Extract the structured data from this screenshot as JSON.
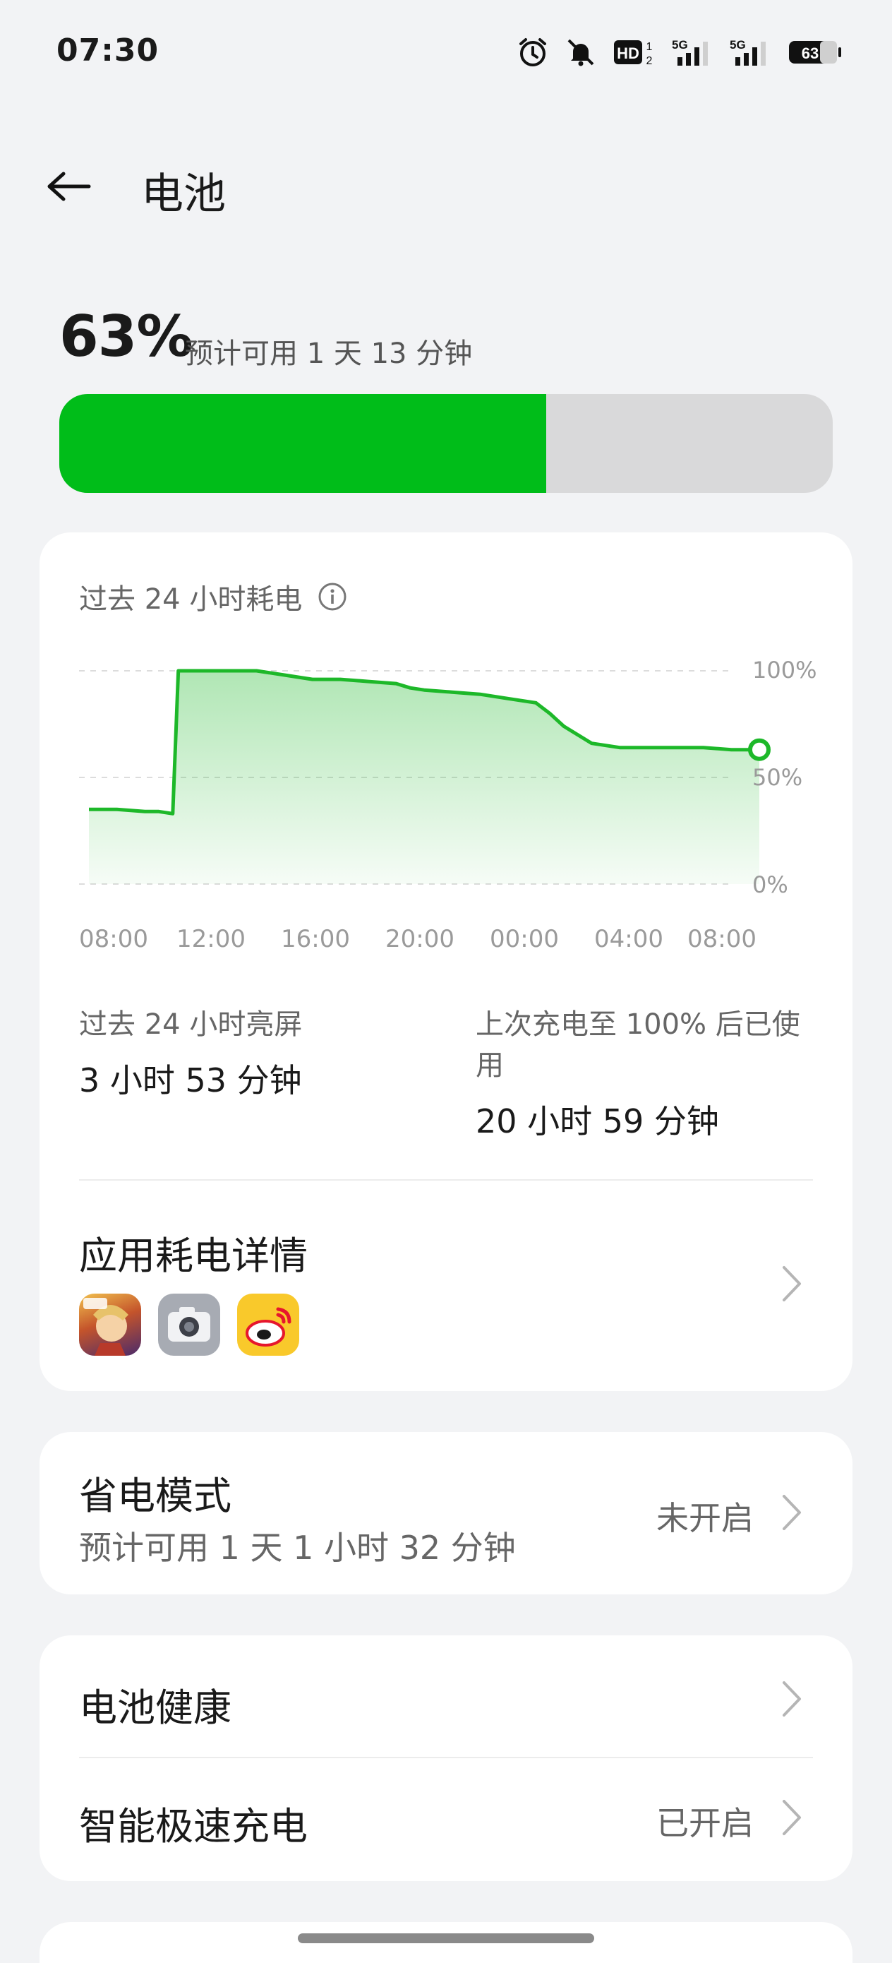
{
  "status_bar": {
    "time": "07:30",
    "icons": [
      "alarm-icon",
      "mute-icon",
      "hd-icon",
      "5g-signal-icon",
      "5g-signal-icon",
      "battery-icon"
    ],
    "hd_text": "HD",
    "hd_sup": "1",
    "hd_sub": "2",
    "network": "5G",
    "battery_level": "63"
  },
  "header": {
    "title": "电池",
    "back_icon": "back-arrow-icon"
  },
  "battery": {
    "percent_text": "63%",
    "level": 0.63,
    "estimate": "预计可用 1 天 13 分钟",
    "fill_color": "#00bd19",
    "track_color": "#d9d9da"
  },
  "usage": {
    "title": "过去 24 小时耗电",
    "info_icon": "info-icon",
    "screen_on_label": "过去 24 小时亮屏",
    "screen_on_value": "3 小时 53 分钟",
    "since_full_label": "上次充电至 100% 后已使用",
    "since_full_value": "20 小时 59 分钟"
  },
  "chart_data": {
    "type": "area",
    "title": "过去 24 小时耗电",
    "x_tick_labels": [
      "08:00",
      "12:00",
      "16:00",
      "20:00",
      "00:00",
      "04:00",
      "08:00"
    ],
    "y_tick_labels": [
      "100%",
      "50%",
      "0%"
    ],
    "ylim": [
      0,
      100
    ],
    "grid": true,
    "series": [
      {
        "color": "#1db829",
        "x_hours": [
          0,
          1,
          2,
          2.5,
          3,
          3.2,
          4,
          5,
          6,
          7,
          8,
          9,
          10,
          11,
          11.5,
          12,
          13,
          14,
          15,
          16,
          16.5,
          17,
          18,
          19,
          20,
          21,
          22,
          23,
          24
        ],
        "y": [
          35,
          35,
          34,
          34,
          33,
          100,
          100,
          100,
          100,
          98,
          96,
          96,
          95,
          94,
          92,
          91,
          90,
          89,
          87,
          85,
          80,
          74,
          66,
          64,
          64,
          64,
          64,
          63,
          63
        ]
      }
    ]
  },
  "app_usage": {
    "title": "应用耗电详情",
    "apps": [
      "game-app-icon",
      "camera-app-icon",
      "weibo-app-icon"
    ]
  },
  "power_saving": {
    "title": "省电模式",
    "subtitle": "预计可用 1 天 1 小时 32 分钟",
    "status": "未开启"
  },
  "health": {
    "battery_health": "电池健康",
    "fast_charge": "智能极速充电",
    "fast_charge_status": "已开启"
  }
}
